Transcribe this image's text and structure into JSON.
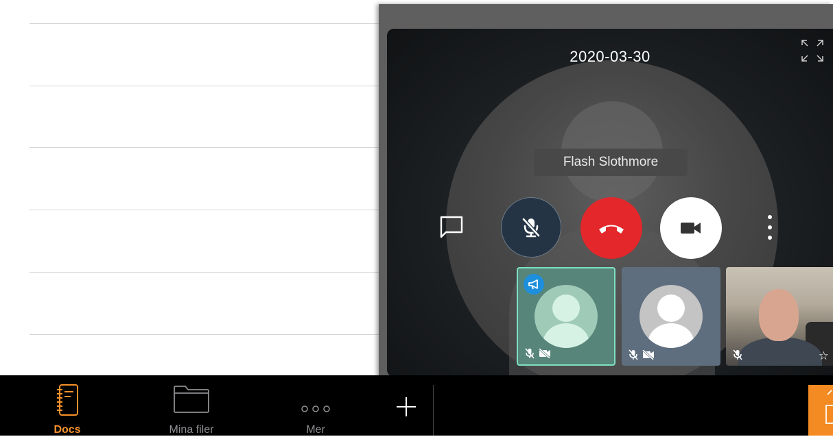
{
  "call": {
    "date": "2020-03-30",
    "participant_name": "Flash Slothmore",
    "controls": {
      "chat": "chat-icon",
      "mute": "microphone-off-icon",
      "hangup": "phone-hangup-icon",
      "video": "video-camera-icon",
      "more": "more-vertical-icon"
    },
    "tiles": [
      {
        "kind": "avatar",
        "presenter": true,
        "muted": true,
        "video_off": true
      },
      {
        "kind": "avatar",
        "presenter": false,
        "muted": true,
        "video_off": true
      },
      {
        "kind": "camera",
        "muted": true,
        "starred": false
      }
    ]
  },
  "tabbar": {
    "tabs": [
      {
        "label": "Docs",
        "icon": "notebook-icon",
        "active": true
      },
      {
        "label": "Mina filer",
        "icon": "folder-icon",
        "active": false
      },
      {
        "label": "Mer",
        "icon": "more-horizontal-icon",
        "active": false
      }
    ],
    "add_icon": "plus-icon"
  },
  "colors": {
    "accent": "#f7922c",
    "hangup": "#e3272b",
    "presenter_badge": "#1e8fdc",
    "active_tile_border": "#7ee0c0"
  }
}
